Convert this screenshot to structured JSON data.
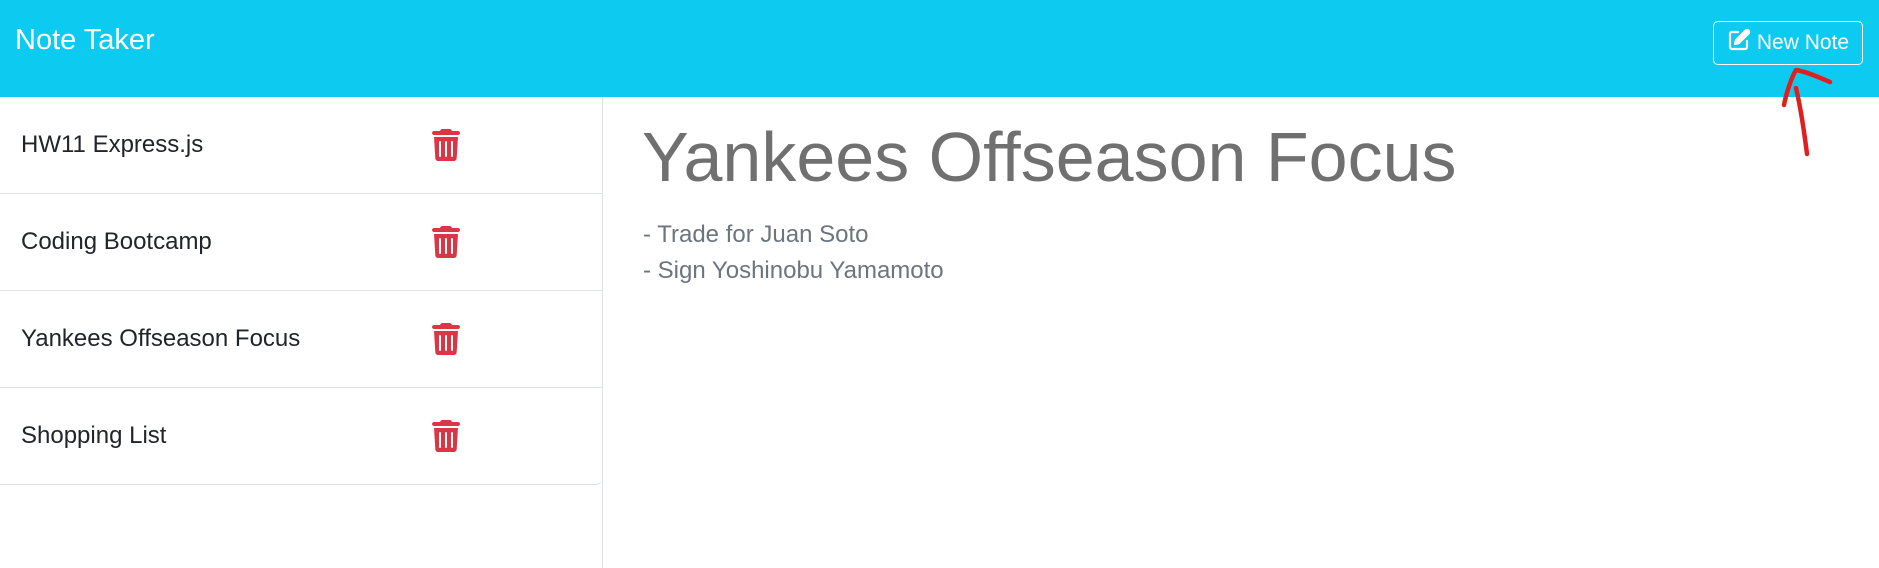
{
  "navbar": {
    "brand": "Note Taker",
    "new_note_label": "New Note",
    "background_color": "#0dcaf0"
  },
  "notes": [
    {
      "title": "HW11 Express.js",
      "delete_icon": "trash-icon"
    },
    {
      "title": "Coding Bootcamp",
      "delete_icon": "trash-icon"
    },
    {
      "title": "Yankees Offseason Focus",
      "delete_icon": "trash-icon"
    },
    {
      "title": "Shopping List",
      "delete_icon": "trash-icon"
    }
  ],
  "active_note": {
    "title": "Yankees Offseason Focus",
    "body": "- Trade for Juan Soto\n- Sign Yoshinobu Yamamoto"
  },
  "colors": {
    "delete": "#dc3545",
    "annotation": "#e02020"
  }
}
